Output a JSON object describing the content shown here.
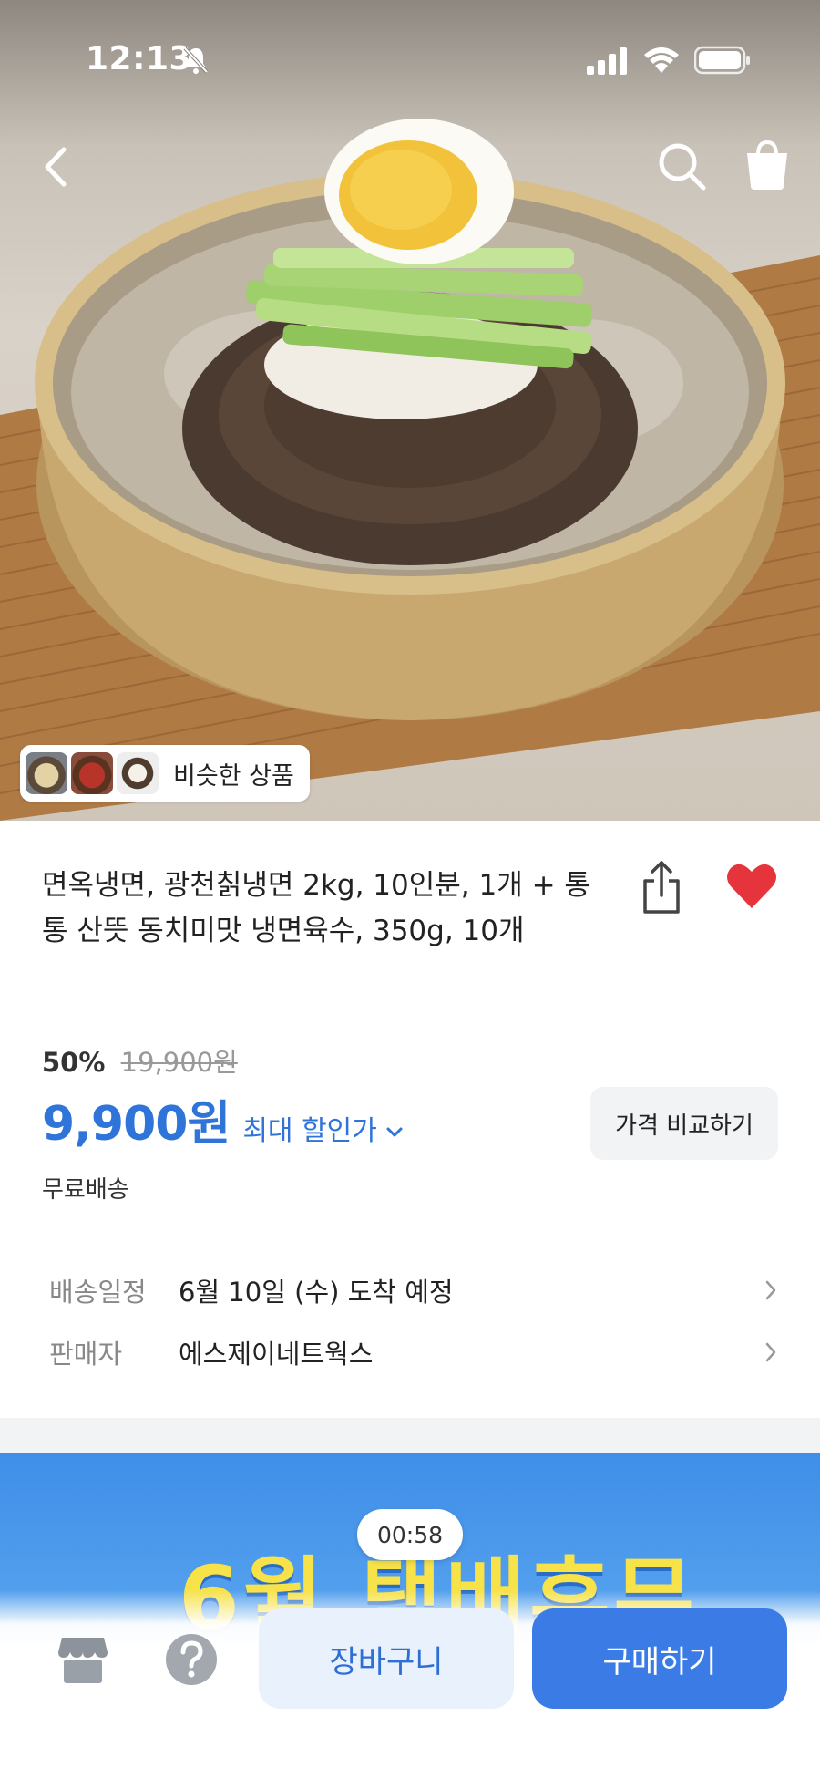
{
  "status_bar": {
    "time": "12:13"
  },
  "hero": {
    "similar_products_label": "비슷한 상품"
  },
  "product": {
    "title": "면옥냉면, 광천칡냉면 2kg, 10인분, 1개 + 통통 산뜻 동치미맛 냉면육수, 350g, 10개",
    "discount_rate": "50%",
    "original_price": "19,900원",
    "sale_price": "9,900원",
    "max_discount_label": "최대 할인가",
    "compare_label": "가격 비교하기",
    "shipping": "무료배송",
    "wishlisted": true
  },
  "meta": [
    {
      "label": "배송일정",
      "value": "6월 10일 (수) 도착 예정"
    },
    {
      "label": "판매자",
      "value": "에스제이네트웍스"
    }
  ],
  "promo": {
    "text": "6월 택배휴무",
    "timer": "00:58"
  },
  "bottom_bar": {
    "cart_label": "장바구니",
    "buy_label": "구매하기"
  },
  "colors": {
    "accent": "#2f74d9",
    "heart": "#e5343c",
    "buy_button": "#3a7be6",
    "cart_button_bg": "#e8f1fc"
  },
  "icons": [
    "bell-slash-icon",
    "signal-icon",
    "wifi-icon",
    "battery-icon",
    "back-icon",
    "search-icon",
    "shopping-bag-icon",
    "share-icon",
    "heart-icon",
    "chevron-down-icon",
    "chevron-right-icon",
    "store-icon",
    "help-icon"
  ]
}
